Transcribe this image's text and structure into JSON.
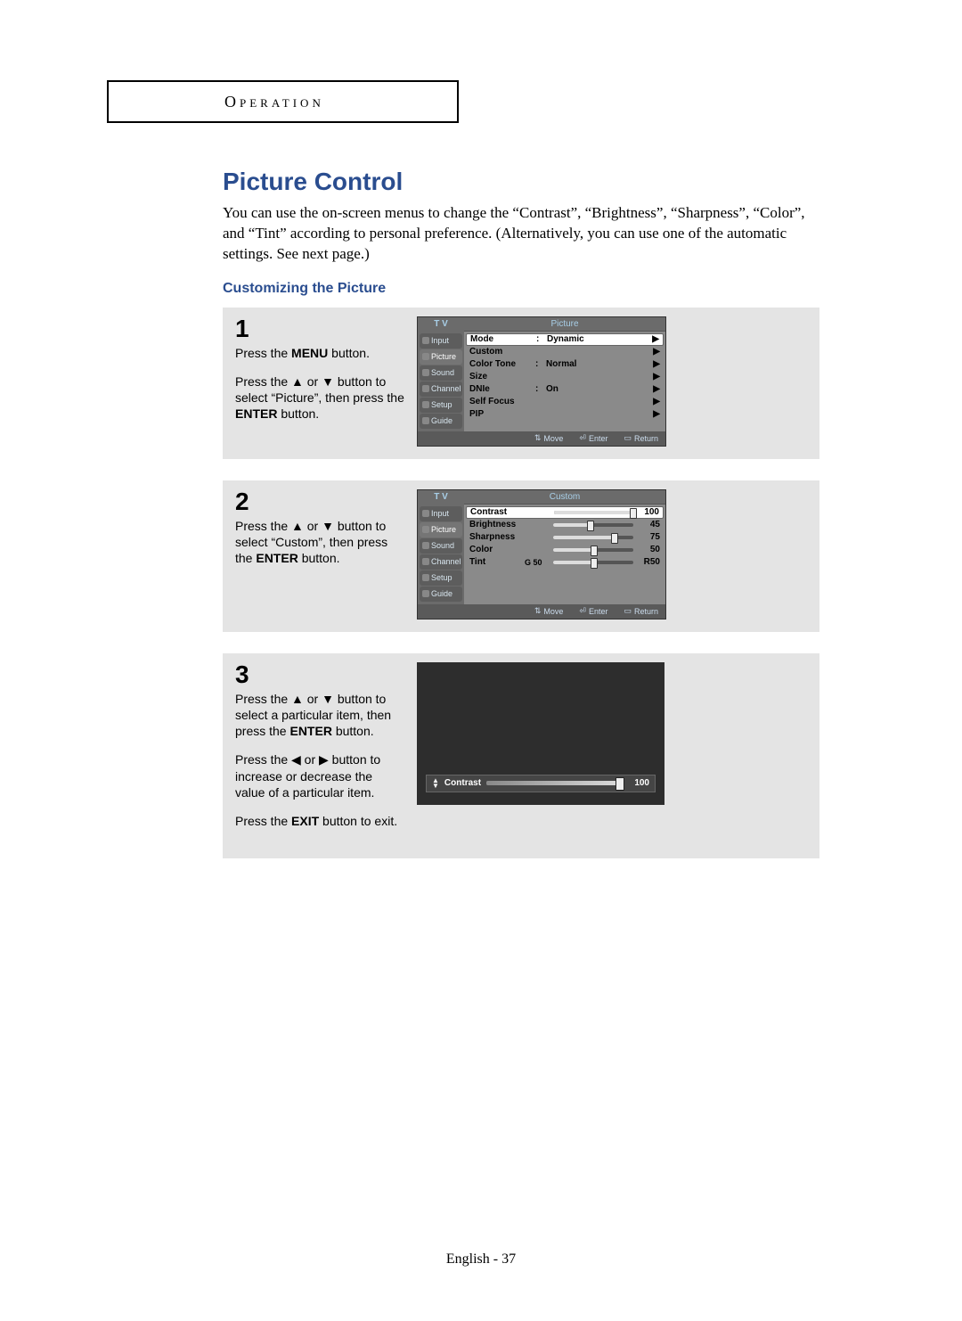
{
  "header": {
    "label": "Operation"
  },
  "section": {
    "title": "Picture Control",
    "intro": "You can use the on-screen menus to change the “Contrast”, “Brightness”, “Sharpness”, “Color”, and “Tint” according to personal preference. (Alternatively, you can use one of the automatic settings. See next page.)",
    "subhead": "Customizing the Picture"
  },
  "steps": {
    "s1": {
      "num": "1",
      "p1a": "Press the ",
      "p1b": "MENU",
      "p1c": " button.",
      "p2a": "Press the ▲ or ▼ button to select “Picture”, then press the ",
      "p2b": "ENTER",
      "p2c": " button."
    },
    "s2": {
      "num": "2",
      "p1a": "Press the ▲ or ▼ button to select “Custom”, then press the ",
      "p1b": "ENTER",
      "p1c": " button."
    },
    "s3": {
      "num": "3",
      "p1a": "Press the ▲ or ▼ button to select a particular item, then press the ",
      "p1b": "ENTER",
      "p1c": " button.",
      "p2": "Press the ◀ or ▶ button to increase or decrease the value of a particular item.",
      "p3a": "Press the ",
      "p3b": "EXIT",
      "p3c": " button to exit."
    }
  },
  "osd1": {
    "title_left": "T V",
    "title_right": "Picture",
    "side": [
      "Input",
      "Picture",
      "Sound",
      "Channel",
      "Setup",
      "Guide"
    ],
    "rows": [
      {
        "label": "Mode",
        "colon": ":",
        "val": "Dynamic",
        "arrow": "▶",
        "sel": true
      },
      {
        "label": "Custom",
        "colon": "",
        "val": "",
        "arrow": "▶"
      },
      {
        "label": "Color Tone",
        "colon": ":",
        "val": "Normal",
        "arrow": "▶"
      },
      {
        "label": "Size",
        "colon": "",
        "val": "",
        "arrow": "▶"
      },
      {
        "label": "DNIe",
        "colon": ":",
        "val": "On",
        "arrow": "▶"
      },
      {
        "label": "Self Focus",
        "colon": "",
        "val": "",
        "arrow": "▶"
      },
      {
        "label": "PIP",
        "colon": "",
        "val": "",
        "arrow": "▶"
      }
    ],
    "footer": {
      "move": "Move",
      "enter": "Enter",
      "return": "Return"
    }
  },
  "osd2": {
    "title_left": "T V",
    "title_right": "Custom",
    "side": [
      "Input",
      "Picture",
      "Sound",
      "Channel",
      "Setup",
      "Guide"
    ],
    "rows": [
      {
        "label": "Contrast",
        "mid": "",
        "pct": 100,
        "value": "100",
        "sel": true
      },
      {
        "label": "Brightness",
        "mid": "",
        "pct": 45,
        "value": "45"
      },
      {
        "label": "Sharpness",
        "mid": "",
        "pct": 75,
        "value": "75"
      },
      {
        "label": "Color",
        "mid": "",
        "pct": 50,
        "value": "50"
      },
      {
        "label": "Tint",
        "mid": "G 50",
        "pct": 50,
        "value": "R50"
      }
    ],
    "footer": {
      "move": "Move",
      "enter": "Enter",
      "return": "Return"
    }
  },
  "osd3": {
    "label": "Contrast",
    "value": "100"
  },
  "footer": {
    "text": "English - 37"
  },
  "chart_data": {
    "type": "table",
    "title": "Picture Custom settings",
    "categories": [
      "Contrast",
      "Brightness",
      "Sharpness",
      "Color",
      "Tint"
    ],
    "values": [
      100,
      45,
      75,
      50,
      50
    ],
    "tint_label": "G 50 / R50"
  }
}
